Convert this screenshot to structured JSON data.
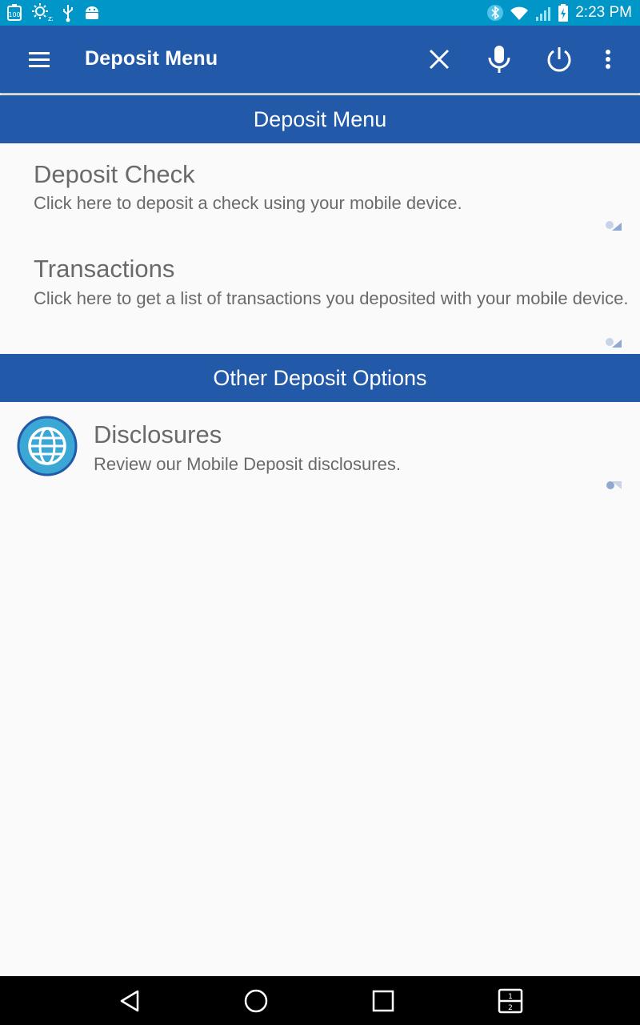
{
  "status_bar": {
    "time": "2:23 PM",
    "battery_badge": "100",
    "icons": [
      "battery-100-icon",
      "sleep-zz-icon",
      "usb-icon",
      "android-icon",
      "bluetooth-icon",
      "wifi-icon",
      "signal-icon",
      "battery-charging-icon"
    ]
  },
  "app_bar": {
    "title": "Deposit Menu",
    "actions": [
      "menu-icon",
      "close-icon",
      "mic-icon",
      "power-icon",
      "more-vert-icon"
    ]
  },
  "sections": [
    {
      "header": "Deposit Menu",
      "items": [
        {
          "title": "Deposit Check",
          "description": "Click here to deposit a check using your mobile device."
        },
        {
          "title": "Transactions",
          "description": "Click here to get a list of transactions you deposited with your mobile device."
        }
      ]
    },
    {
      "header": "Other Deposit Options",
      "items": [
        {
          "title": "Disclosures",
          "description": "Review our Mobile Deposit disclosures.",
          "icon": "globe-icon"
        }
      ]
    }
  ],
  "nav_bar": {
    "buttons": [
      "back-icon",
      "home-icon",
      "recents-icon",
      "split-screen-icon"
    ],
    "split_label_top": "1",
    "split_label_bottom": "2"
  },
  "colors": {
    "status_bar": "#0096c7",
    "app_bar": "#2259a8",
    "background": "#fafafa",
    "text_gray": "#6a6a6a",
    "globe_fill": "#3aa7d4"
  }
}
